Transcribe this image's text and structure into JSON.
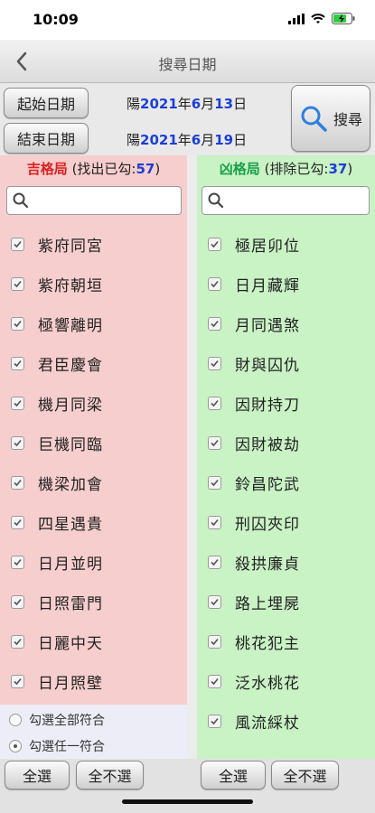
{
  "status": {
    "time": "10:09"
  },
  "nav": {
    "title": "搜尋日期"
  },
  "dates": {
    "start_button": "起始日期",
    "end_button": "結束日期",
    "start": {
      "prefix": "陽",
      "year": "2021",
      "year_unit": "年",
      "month": "6",
      "month_unit": "月",
      "day": "13",
      "day_unit": "日"
    },
    "end": {
      "prefix": "陽",
      "year": "2021",
      "year_unit": "年",
      "month": "6",
      "month_unit": "月",
      "day": "19",
      "day_unit": "日"
    },
    "search_label": "搜尋"
  },
  "left": {
    "title": "吉格局",
    "subtitle_open": " (找出已勾:",
    "count": "57",
    "subtitle_close": ")",
    "items": [
      "紫府同宮",
      "紫府朝垣",
      "極響離明",
      "君臣慶會",
      "機月同梁",
      "巨機同臨",
      "機梁加會",
      "四星遇貴",
      "日月並明",
      "日照雷門",
      "日麗中天",
      "日月照壁"
    ],
    "radio_all": "勾選全部符合",
    "radio_any": "勾選任一符合",
    "select_all": "全選",
    "select_none": "全不選"
  },
  "right": {
    "title": "凶格局",
    "subtitle_open": " (排除已勾:",
    "count": "37",
    "subtitle_close": ")",
    "items": [
      "極居卯位",
      "日月藏輝",
      "月同遇煞",
      "財與囚仇",
      "因財持刀",
      "因財被劫",
      "鈴昌陀武",
      "刑囚夾印",
      "殺拱廉貞",
      "路上埋屍",
      "桃花犯主",
      "泛水桃花",
      "風流綵杖"
    ],
    "select_all": "全選",
    "select_none": "全不選"
  },
  "colors": {
    "left_bg": "#f7cece",
    "right_bg": "#c9f2c5",
    "accent_blue": "#1b3fd6",
    "good_red": "#e02020",
    "bad_green": "#1aa04a"
  }
}
